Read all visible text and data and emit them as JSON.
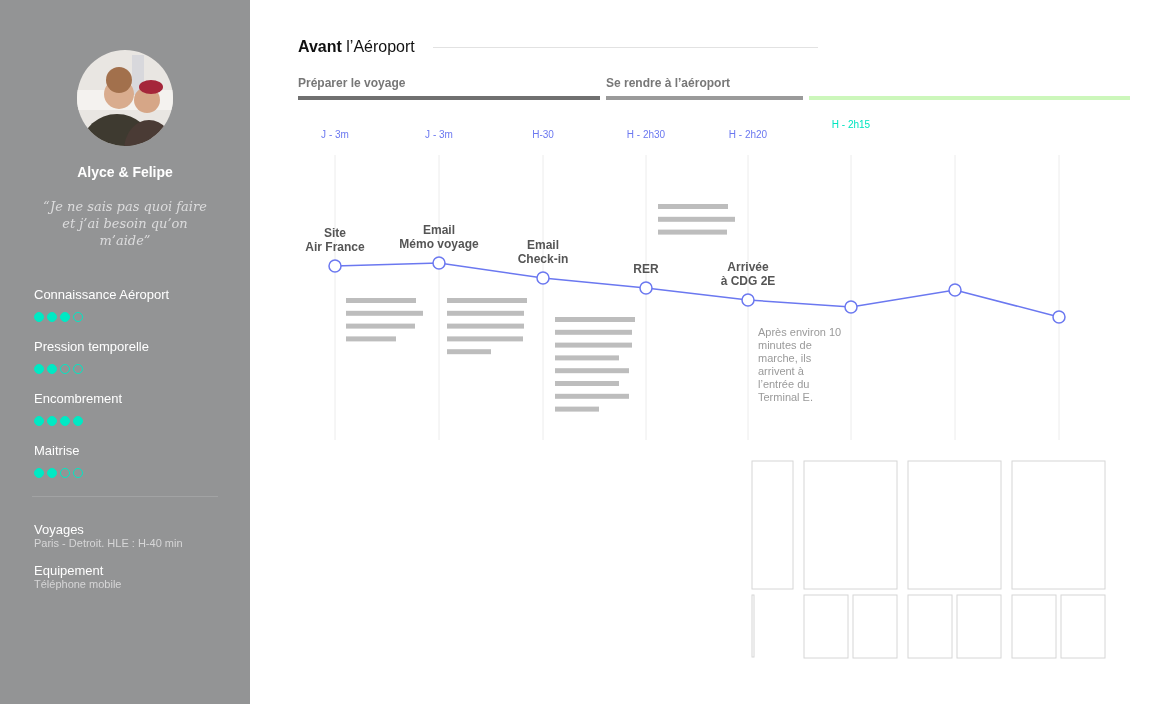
{
  "profile": {
    "name": "Alyce & Felipe",
    "quote": "“Je ne sais pas quoi faire et j’ai besoin qu’on m’aide”"
  },
  "ratings": [
    {
      "label": "Connaissance Aéroport",
      "stars": 3
    },
    {
      "label": "Pression temporelle",
      "stars": 2
    },
    {
      "label": "Encombrement",
      "stars": 4
    },
    {
      "label": "Maitrise",
      "stars": 2
    }
  ],
  "info": [
    {
      "label": "Voyages",
      "value": "Paris - Detroit. HLE : H-40 min"
    },
    {
      "label": "Equipement",
      "value": "Téléphone mobile"
    }
  ],
  "title": "**Avant** l’Aéroport",
  "phases": [
    {
      "label": "Préparer le voyage",
      "color": "#707070"
    },
    {
      "label": "Se rendre à l’aéroport",
      "color": "#9a9a9a"
    },
    {
      "color": "#ccf7bb"
    }
  ],
  "steps": [
    {
      "kind": "node",
      "time": "J - 3m",
      "color": "#6b78f0",
      "title": [
        "Site",
        "Air France"
      ]
    },
    {
      "kind": "node",
      "time": "J - 3m",
      "color": "#6b78f0",
      "title": [
        "Email",
        "Mémo voyage"
      ]
    },
    {
      "kind": "node",
      "time": "H-30",
      "color": "#6b78f0",
      "title": [
        "Email",
        "Check-in"
      ]
    },
    {
      "kind": "node",
      "time": "H - 2h30",
      "color": "#6b78f0",
      "title": [
        "RER"
      ]
    },
    {
      "kind": "node",
      "time": "H - 2h20",
      "color": "#6b78f0",
      "title": [
        "Arrivée",
        "à CDG 2E"
      ],
      "note": "Après environ 10 minutes de marche, ils arrivent à l’entrée du Terminal E."
    },
    {
      "kind": "node",
      "time": "H - 2h15",
      "color": "#00e5c0"
    },
    {
      "kind": "node"
    },
    {
      "kind": "node"
    }
  ]
}
